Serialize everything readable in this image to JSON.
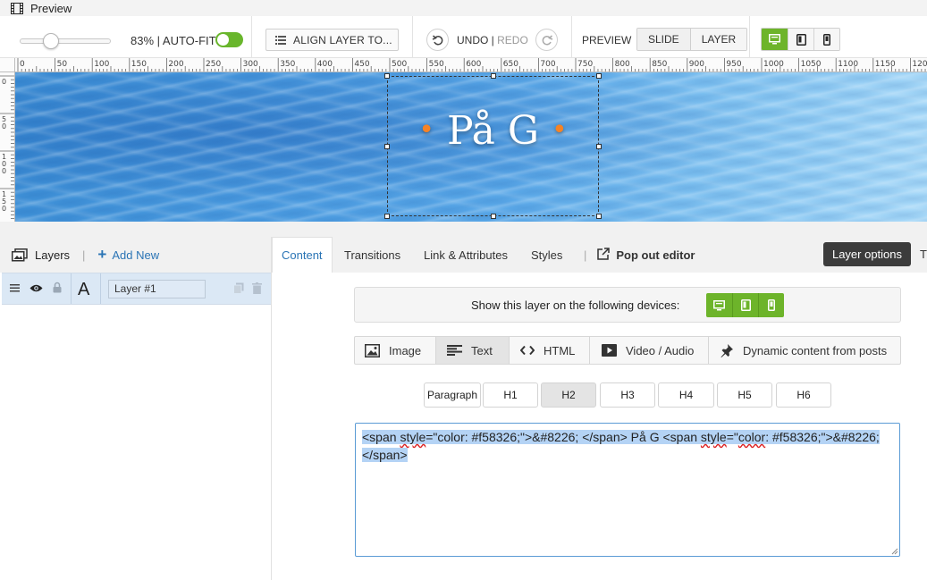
{
  "window": {
    "title": "Preview"
  },
  "toolbar": {
    "zoom_label": "83% | AUTO-FIT",
    "align_label": "ALIGN LAYER TO...",
    "undo_label": "UNDO",
    "separator": " | ",
    "redo_label": "REDO",
    "preview_label": "PREVIEW",
    "preview_modes": [
      "SLIDE",
      "LAYER"
    ]
  },
  "ruler": {
    "top_labels": [
      "0",
      "50",
      "100",
      "150",
      "200",
      "250",
      "300",
      "350",
      "400",
      "450",
      "500",
      "550",
      "600",
      "650",
      "700",
      "750",
      "800",
      "850",
      "900",
      "950",
      "1000",
      "1050",
      "1100",
      "1150",
      "120"
    ],
    "left_labels": [
      "0",
      "50",
      "100",
      "150"
    ]
  },
  "canvas": {
    "layer_dot": "•",
    "layer_text": "På G"
  },
  "layers_panel": {
    "title": "Layers",
    "pipe": "|",
    "add_new": "Add New",
    "layer_type_glyph": "A",
    "layer_name": "Layer #1"
  },
  "content_panel": {
    "tabs": [
      "Content",
      "Transitions",
      "Link & Attributes",
      "Styles"
    ],
    "pipe": "|",
    "popout_label": "Pop out editor",
    "layer_options": "Layer options",
    "cut_off_tab": "T",
    "devices_label": "Show this layer on the following devices:",
    "type_tabs": [
      "Image",
      "Text",
      "HTML",
      "Video / Audio",
      "Dynamic content from posts"
    ],
    "heading_options": [
      "Paragraph",
      "H1",
      "H2",
      "H3",
      "H4",
      "H5",
      "H6"
    ],
    "editor": {
      "part1": "<span ",
      "word_style_1": "style",
      "part2": "=\"color: #f58326;\">&#8226; </span> På G <span ",
      "word_style_2": "style",
      "part3": "=\"",
      "word_color": "color",
      "part4": ": #f58326;\">&#8226; </span>"
    }
  },
  "colors": {
    "accent_green": "#6db42a",
    "accent_blue": "#2a74b5",
    "dot_orange": "#f58326"
  }
}
